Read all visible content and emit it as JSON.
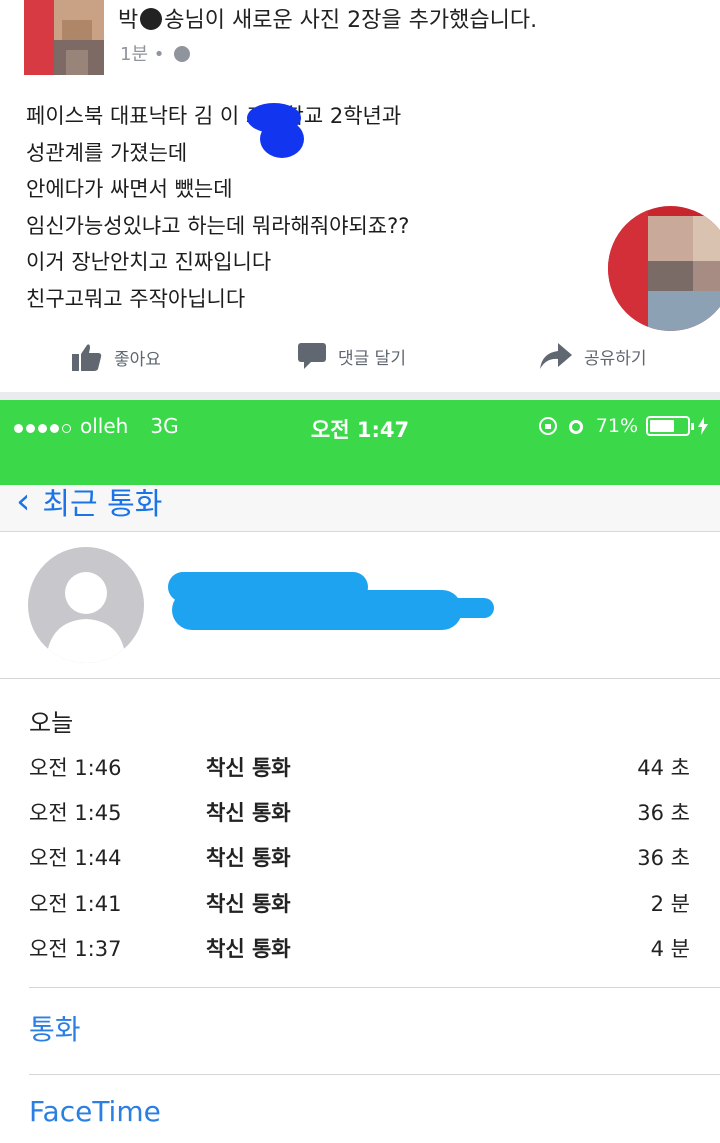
{
  "post": {
    "author_prefix": "박",
    "author_suffix": "송",
    "header_text": "님이 새로운 사진 2장을 추가했습니다.",
    "time": "1분",
    "separator": "•",
    "lines": [
      "페이스북 대표낙타 김      이 고등학교 2학년과",
      "성관계를 가졌는데",
      "안에다가 싸면서 뺐는데",
      "임신가능성있냐고 하는데 뭐라해줘야되죠??",
      "이거 장난안치고 진짜입니다",
      "친구고뭐고 주작아닙니다"
    ],
    "actions": [
      {
        "label": "좋아요",
        "icon": "thumbs-up-icon"
      },
      {
        "label": "댓글 달기",
        "icon": "comment-icon"
      },
      {
        "label": "공유하기",
        "icon": "share-icon"
      }
    ]
  },
  "statusbar": {
    "carrier": "olleh",
    "network": "3G",
    "time": "오전 1:47",
    "battery": "71%",
    "battery_level": 0.71,
    "color": "#3bd94a"
  },
  "nav": {
    "back_label": "최근 통화"
  },
  "calls": {
    "section": "오늘",
    "rows": [
      {
        "time": "오전 1:46",
        "type": "착신 통화",
        "duration": "44 초"
      },
      {
        "time": "오전 1:45",
        "type": "착신 통화",
        "duration": "36 초"
      },
      {
        "time": "오전 1:44",
        "type": "착신 통화",
        "duration": "36 초"
      },
      {
        "time": "오전 1:41",
        "type": "착신 통화",
        "duration": "2 분"
      },
      {
        "time": "오전 1:37",
        "type": "착신 통화",
        "duration": "4 분"
      }
    ]
  },
  "links": {
    "call": "통화",
    "facetime": "FaceTime"
  },
  "colors": {
    "accent_blue": "#2a7fe3",
    "scribble": "#1da3f0",
    "status_green": "#3bd94a"
  }
}
